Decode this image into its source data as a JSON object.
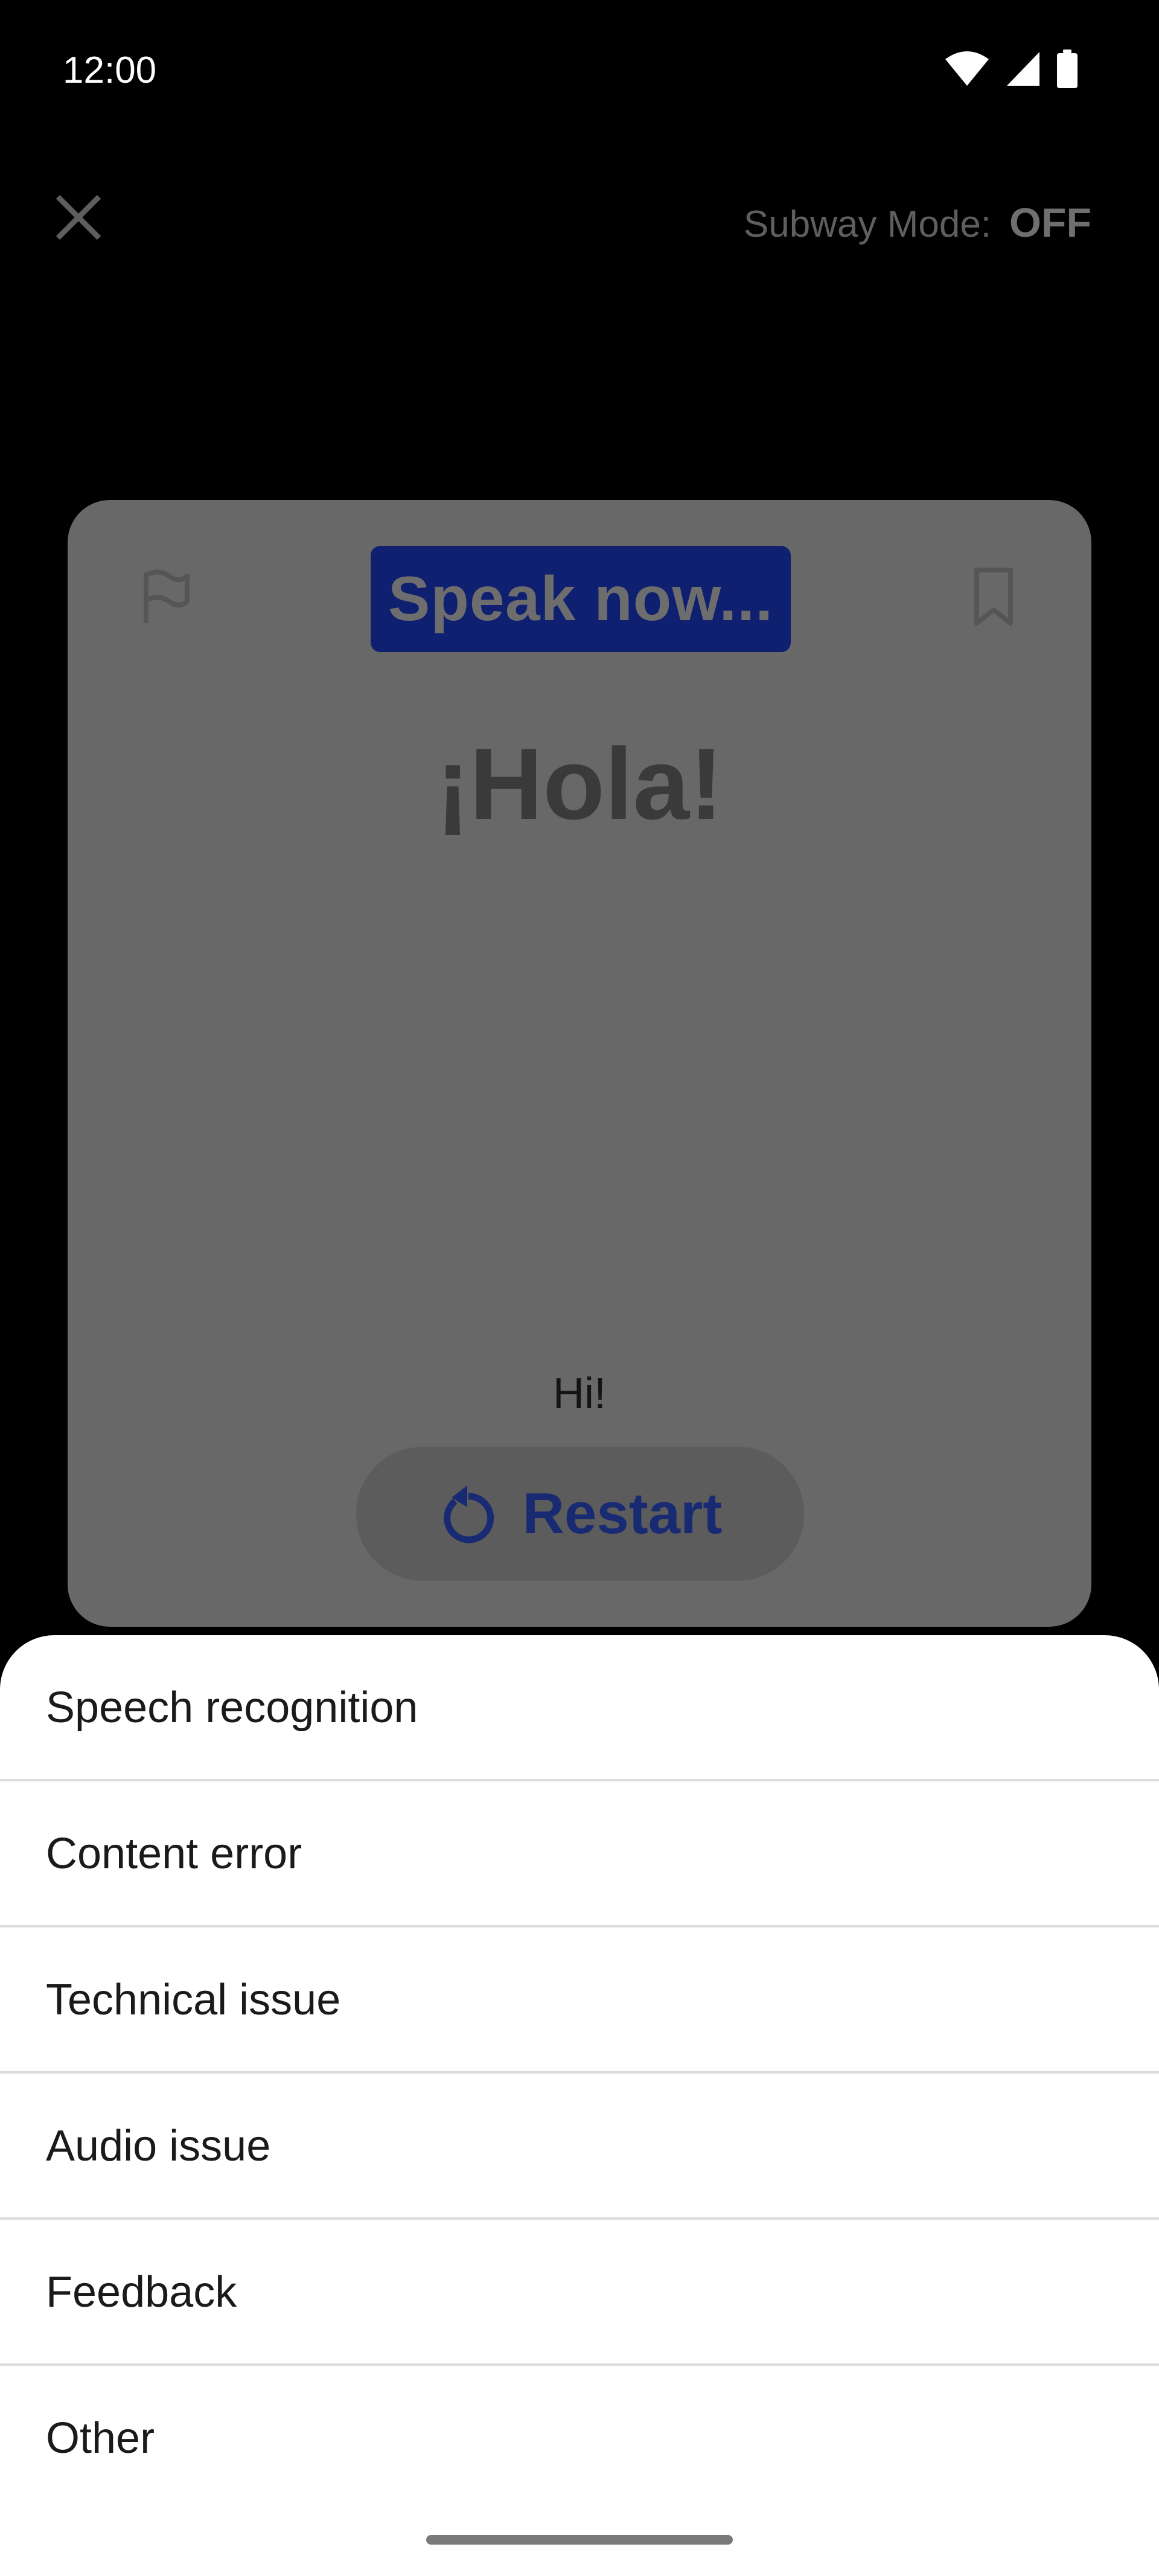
{
  "status_bar": {
    "time": "12:00",
    "icons": [
      "wifi-icon",
      "cell-signal-icon",
      "battery-icon"
    ]
  },
  "top_bar": {
    "close_icon": "close-icon",
    "subway_mode_label": "Subway Mode:",
    "subway_mode_state": "OFF"
  },
  "card": {
    "flag_icon": "flag-icon",
    "bookmark_icon": "bookmark-icon",
    "speak_prompt": "Speak now...",
    "phrase": "¡Hola!",
    "translation": "Hi!",
    "restart_label": "Restart",
    "restart_icon": "restart-icon"
  },
  "sheet": {
    "items": [
      {
        "label": "Speech recognition"
      },
      {
        "label": "Content error"
      },
      {
        "label": "Technical issue"
      },
      {
        "label": "Audio issue"
      },
      {
        "label": "Feedback"
      },
      {
        "label": "Other"
      }
    ]
  },
  "colors": {
    "background": "#000000",
    "card": "#686868",
    "speak_badge": "#0f2070",
    "restart_text": "#182a72",
    "sheet": "#ffffff",
    "divider": "#dcdcdc"
  }
}
